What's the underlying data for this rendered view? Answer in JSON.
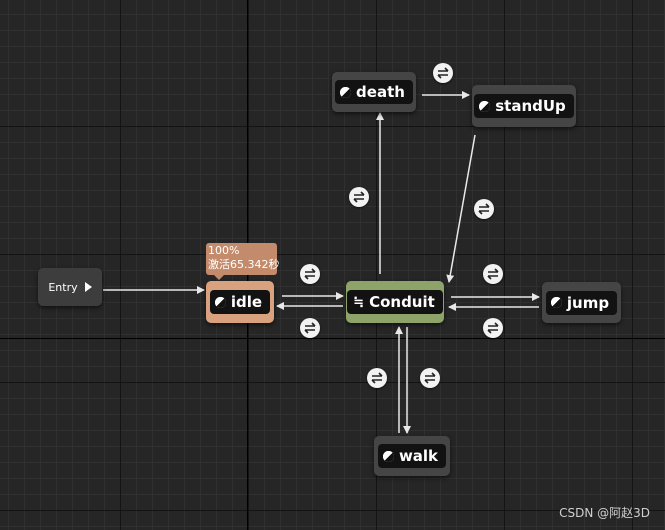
{
  "graph": {
    "entry": {
      "label": "Entry"
    },
    "states": {
      "idle": "idle",
      "conduit": "Conduit",
      "death": "death",
      "standup": "standUp",
      "jump": "jump",
      "walk": "walk"
    },
    "idle_tooltip": {
      "line1": "100%",
      "line2": "激活65.342秒"
    }
  },
  "watermark": "CSDN @阿赵3D",
  "colors": {
    "background": "#262626",
    "state_node": "#454545",
    "idle_node": "#d9a27f",
    "conduit_node": "#8da36a",
    "tooltip": "#c38b6b",
    "wire": "#e8e8e8"
  }
}
